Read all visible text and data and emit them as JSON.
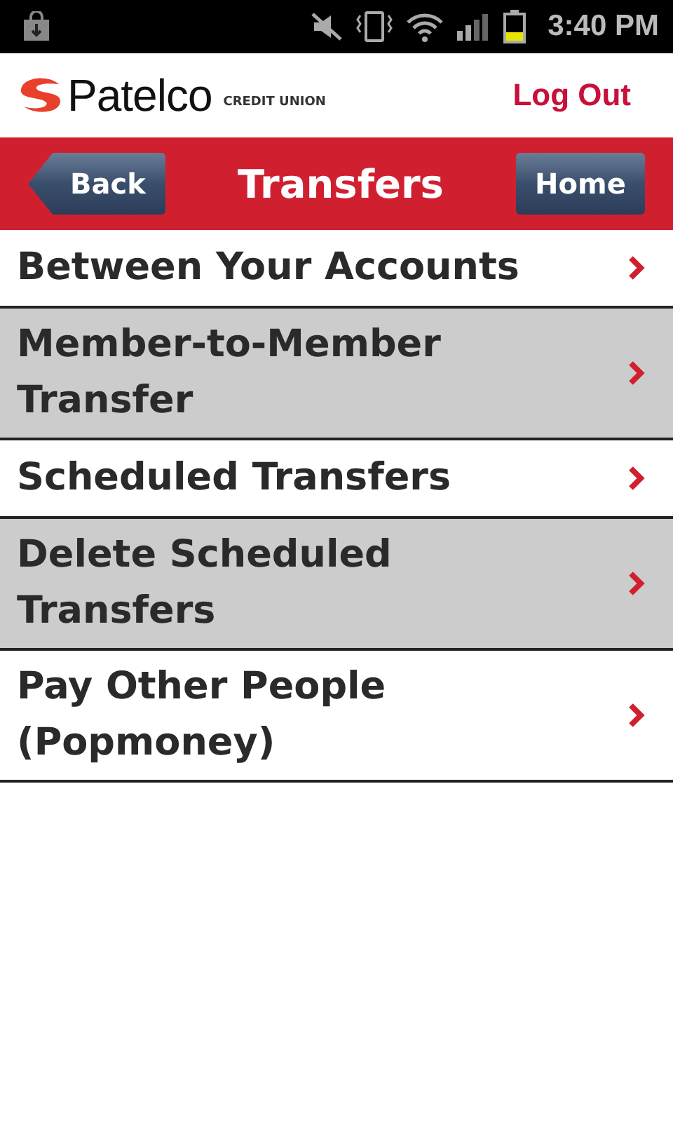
{
  "status_bar": {
    "time": "3:40 PM"
  },
  "header": {
    "logo_name": "Patelco",
    "logo_sub": "CREDIT UNION",
    "logout": "Log Out"
  },
  "nav": {
    "back": "Back",
    "title": "Transfers",
    "home": "Home"
  },
  "menu": [
    {
      "label": "Between Your Accounts"
    },
    {
      "label": "Member-to-Member Transfer"
    },
    {
      "label": "Scheduled Transfers"
    },
    {
      "label": "Delete Scheduled Transfers"
    },
    {
      "label": "Pay Other People (Popmoney)"
    }
  ]
}
